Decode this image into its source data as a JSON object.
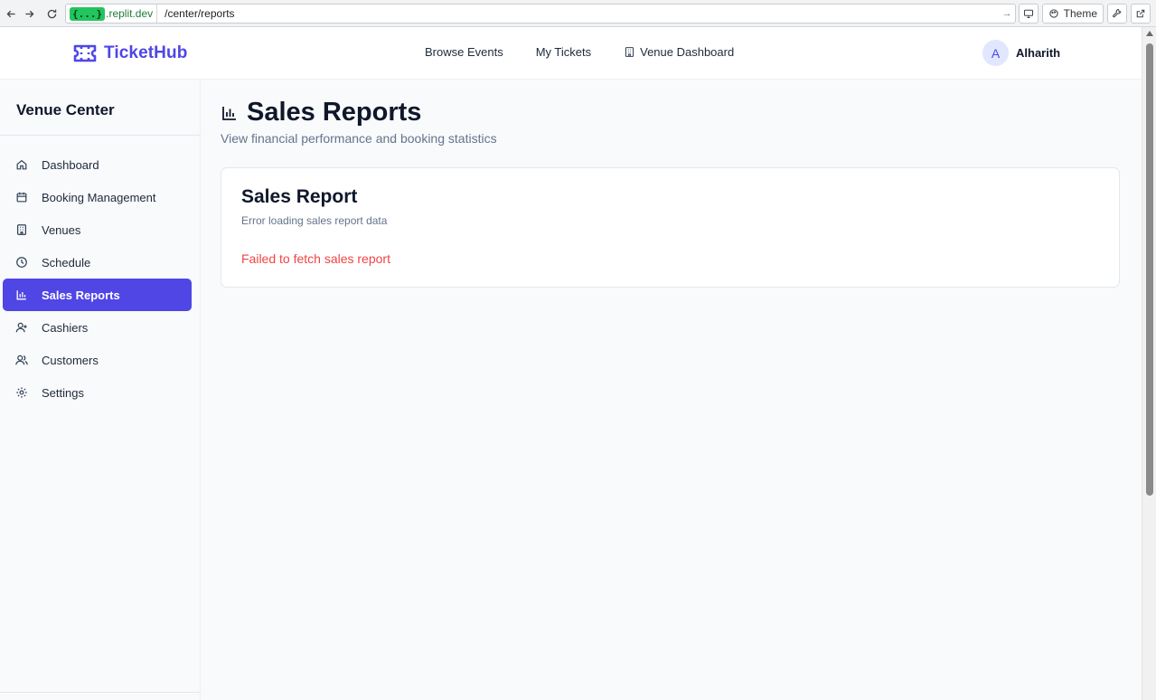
{
  "browser": {
    "url_badge": "{...}",
    "url_host": ".replit.dev",
    "url_path": "/center/reports",
    "theme_label": "Theme"
  },
  "header": {
    "brand": "TicketHub",
    "nav": [
      {
        "label": "Browse Events"
      },
      {
        "label": "My Tickets"
      },
      {
        "label": "Venue Dashboard"
      }
    ],
    "user": {
      "initial": "A",
      "name": "Alharith"
    }
  },
  "sidebar": {
    "title": "Venue Center",
    "items": [
      {
        "label": "Dashboard",
        "icon": "home-icon"
      },
      {
        "label": "Booking Management",
        "icon": "calendar-icon"
      },
      {
        "label": "Venues",
        "icon": "building-icon"
      },
      {
        "label": "Schedule",
        "icon": "clock-icon"
      },
      {
        "label": "Sales Reports",
        "icon": "bar-chart-icon",
        "active": true
      },
      {
        "label": "Cashiers",
        "icon": "user-plus-icon"
      },
      {
        "label": "Customers",
        "icon": "users-icon"
      },
      {
        "label": "Settings",
        "icon": "gear-icon"
      }
    ]
  },
  "main": {
    "title": "Sales Reports",
    "subtitle": "View financial performance and booking statistics",
    "card": {
      "title": "Sales Report",
      "description": "Error loading sales report data",
      "error": "Failed to fetch sales report"
    }
  },
  "colors": {
    "accent": "#4f46e5",
    "error": "#ef4444",
    "muted": "#64748b"
  }
}
